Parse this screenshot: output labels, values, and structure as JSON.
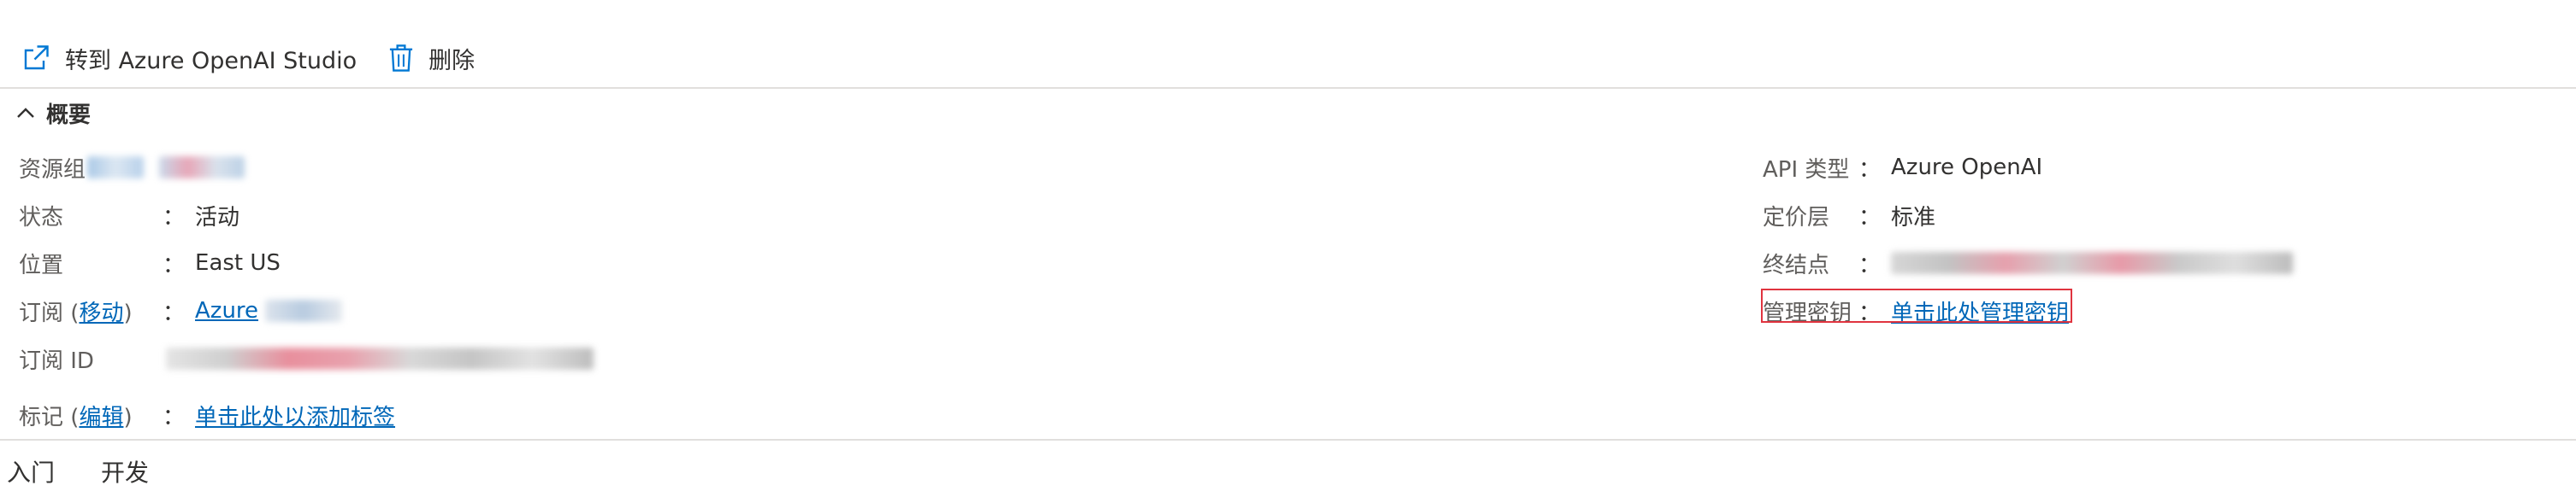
{
  "toolbar": {
    "open_studio_label": "转到 Azure OpenAI Studio",
    "delete_label": "删除"
  },
  "overview": {
    "header": "概要",
    "left": {
      "resource_group_label": "资源组",
      "status_label": "状态",
      "status_value": "活动",
      "location_label": "位置",
      "location_value": "East US",
      "subscription_label": "订阅",
      "subscription_move_link": "移动",
      "subscription_value": "Azure",
      "subscription_id_label": "订阅 ID",
      "tags_label": "标记",
      "tags_edit_link": "编辑",
      "tags_value": "单击此处以添加标签"
    },
    "right": {
      "api_type_label": "API 类型",
      "api_type_value": "Azure OpenAI",
      "pricing_tier_label": "定价层",
      "pricing_tier_value": "标准",
      "endpoint_label": "终结点",
      "manage_keys_label": "管理密钥",
      "manage_keys_value": "单击此处管理密钥"
    },
    "colon": "："
  },
  "tabs": [
    "入门",
    "开发"
  ],
  "colors": {
    "link": "#0067b8",
    "highlight": "#e0343f",
    "icon": "#0078d4"
  }
}
